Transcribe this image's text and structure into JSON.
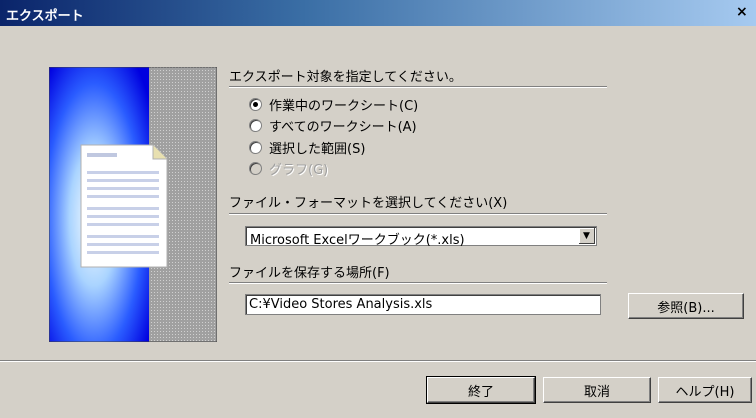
{
  "window": {
    "title": "エクスポート",
    "close_glyph": "×"
  },
  "export_target": {
    "heading": "エクスポート対象を指定してください。",
    "options": [
      {
        "label": "作業中のワークシート(C)",
        "checked": true,
        "disabled": false
      },
      {
        "label": "すべてのワークシート(A)",
        "checked": false,
        "disabled": false
      },
      {
        "label": "選択した範囲(S)",
        "checked": false,
        "disabled": false
      },
      {
        "label": "グラフ(G)",
        "checked": false,
        "disabled": true
      }
    ]
  },
  "file_format": {
    "heading": "ファイル・フォーマットを選択してください(X)",
    "selected": "Microsoft Excelワークブック(*.xls)"
  },
  "save_location": {
    "heading": "ファイルを保存する場所(F)",
    "path": "C:¥Video Stores Analysis.xls",
    "browse_label": "参照(B)..."
  },
  "buttons": {
    "finish": "終了",
    "cancel": "取消",
    "help": "ヘルプ(H)"
  },
  "icons": {
    "dropdown": "dropdown-arrow-icon",
    "close": "close-icon",
    "illustration": "export-document-illustration"
  }
}
